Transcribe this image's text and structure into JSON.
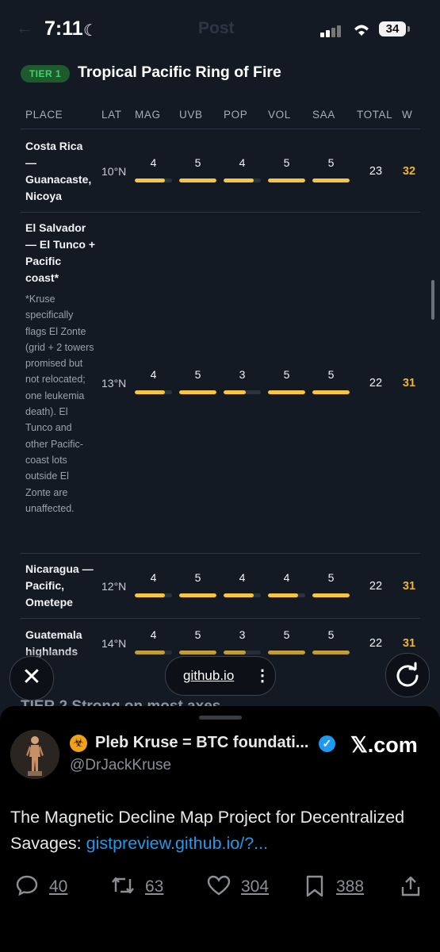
{
  "status": {
    "time": "7:11",
    "battery": "34",
    "faded_title": "Post"
  },
  "tier": {
    "badge": "TIER 1",
    "title": "Tropical Pacific Ring of Fire"
  },
  "table": {
    "headers": [
      "PLACE",
      "LAT",
      "MAG",
      "UVB",
      "POP",
      "VOL",
      "SAA",
      "TOTAL",
      "W"
    ],
    "max_score": 5,
    "rows": [
      {
        "place": "Costa Rica — Guanacaste, Nicoya",
        "note": "",
        "lat": "10°N",
        "scores": [
          "4",
          "5",
          "4",
          "5",
          "5"
        ],
        "total": "23",
        "w": "32"
      },
      {
        "place": "El Salvador — El Tunco + Pacific coast*",
        "note": "*Kruse specifically flags El Zonte (grid + 2 towers promised but not relocated; one leukemia death). El Tunco and other Pacific-coast lots outside El Zonte are unaffected.",
        "lat": "13°N",
        "scores": [
          "4",
          "5",
          "3",
          "5",
          "5"
        ],
        "total": "22",
        "w": "31"
      },
      {
        "place": "Nicaragua — Pacific, Ometepe",
        "note": "",
        "lat": "12°N",
        "scores": [
          "4",
          "5",
          "4",
          "4",
          "5"
        ],
        "total": "22",
        "w": "31"
      },
      {
        "place": "Guatemala highlands",
        "note": "",
        "lat": "14°N",
        "scores": [
          "4",
          "5",
          "3",
          "5",
          "5"
        ],
        "total": "22",
        "w": "31"
      }
    ]
  },
  "peek_text": "TIER 2  Strong on most axes",
  "browser": {
    "url": "github.io"
  },
  "tweet": {
    "display_name": "Pleb Kruse = BTC foundati...",
    "handle": "@DrJackKruse",
    "source": "𝕏.com",
    "text": "The Magnetic Decline Map Project for Decentralized Savages: ",
    "link": "gistpreview.github.io/?...",
    "replies": "40",
    "reposts": "63",
    "likes": "304",
    "bookmarks": "388"
  },
  "colors": {
    "accent_yellow": "#f6c544",
    "w_orange": "#f0b429",
    "tier_green": "#3fd466",
    "link_blue": "#1d9bf0"
  },
  "icons": [
    "moon-icon",
    "signal-icon",
    "wifi-icon",
    "close-icon",
    "more-vertical-icon",
    "reload-icon",
    "biohazard-icon",
    "verified-icon",
    "reply-icon",
    "repost-icon",
    "like-icon",
    "bookmark-icon",
    "share-icon"
  ]
}
